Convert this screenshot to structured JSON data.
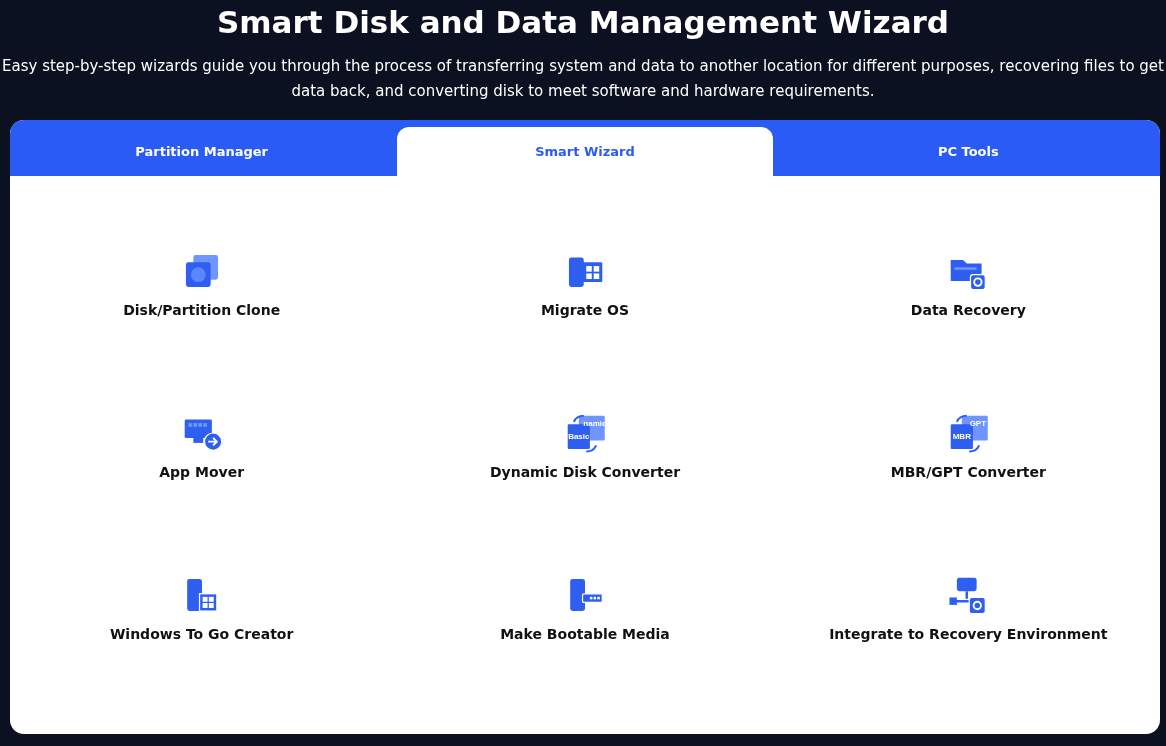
{
  "title": "Smart Disk and Data Management Wizard",
  "subtitle": "Easy step-by-step wizards guide you through the process of transferring system and data to another location for different purposes, recovering files to get data back, and converting disk to meet software and hardware requirements.",
  "tabs": [
    {
      "label": "Partition Manager",
      "selected": false
    },
    {
      "label": "Smart Wizard",
      "selected": true
    },
    {
      "label": "PC Tools",
      "selected": false
    }
  ],
  "tool_rows": [
    {
      "tools": [
        {
          "kind": "clone",
          "label": "Disk/Partition Clone"
        },
        {
          "kind": "migrate",
          "label": "Migrate OS"
        },
        {
          "kind": "recovery",
          "label": "Data Recovery"
        }
      ]
    },
    {
      "tools": [
        {
          "kind": "appmove",
          "label": "App Mover"
        },
        {
          "kind": "convert",
          "label": "Dynamic Disk Converter",
          "icon_texts": [
            "Basic",
            "namic"
          ]
        },
        {
          "kind": "convert",
          "label": "MBR/GPT Converter",
          "icon_texts": [
            "MBR",
            "GPT"
          ]
        }
      ]
    },
    {
      "tools": [
        {
          "kind": "wintogo",
          "label": "Windows To Go Creator"
        },
        {
          "kind": "bootable",
          "label": "Make Bootable Media"
        },
        {
          "kind": "integrate",
          "label": "Integrate to Recovery Environment"
        }
      ]
    }
  ]
}
